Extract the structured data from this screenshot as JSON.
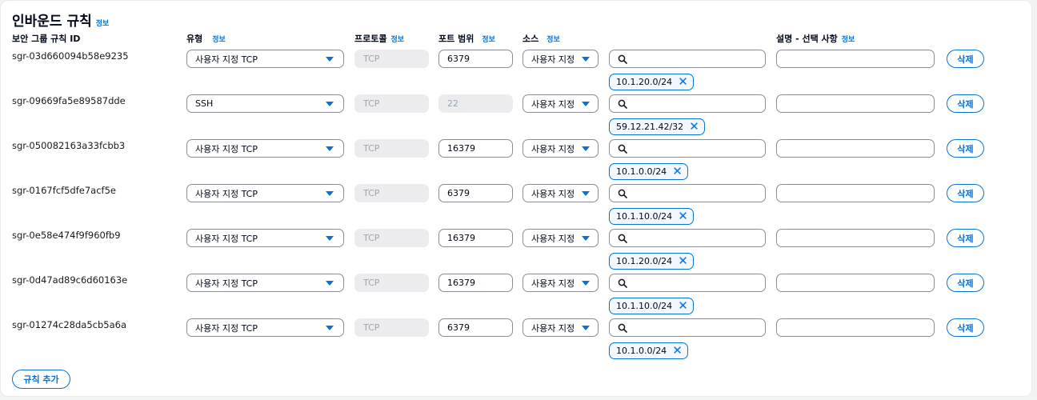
{
  "title": "인바운드 규칙",
  "info_label": "정보",
  "headers": {
    "rule_id": "보안 그룹 규칙 ID",
    "type": "유형",
    "protocol": "프로토콜",
    "port": "포트 범위",
    "source": "소스",
    "description": "설명 - 선택 사항"
  },
  "rules": [
    {
      "id": "sgr-03d660094b58e9235",
      "type": "사용자 지정 TCP",
      "protocol": "TCP",
      "port": "6379",
      "port_disabled": false,
      "source": "사용자 지정",
      "cidr": "10.1.20.0/24"
    },
    {
      "id": "sgr-09669fa5e89587dde",
      "type": "SSH",
      "protocol": "TCP",
      "port": "22",
      "port_disabled": true,
      "source": "사용자 지정",
      "cidr": "59.12.21.42/32"
    },
    {
      "id": "sgr-050082163a33fcbb3",
      "type": "사용자 지정 TCP",
      "protocol": "TCP",
      "port": "16379",
      "port_disabled": false,
      "source": "사용자 지정",
      "cidr": "10.1.0.0/24"
    },
    {
      "id": "sgr-0167fcf5dfe7acf5e",
      "type": "사용자 지정 TCP",
      "protocol": "TCP",
      "port": "6379",
      "port_disabled": false,
      "source": "사용자 지정",
      "cidr": "10.1.10.0/24"
    },
    {
      "id": "sgr-0e58e474f9f960fb9",
      "type": "사용자 지정 TCP",
      "protocol": "TCP",
      "port": "16379",
      "port_disabled": false,
      "source": "사용자 지정",
      "cidr": "10.1.20.0/24"
    },
    {
      "id": "sgr-0d47ad89c6d60163e",
      "type": "사용자 지정 TCP",
      "protocol": "TCP",
      "port": "16379",
      "port_disabled": false,
      "source": "사용자 지정",
      "cidr": "10.1.10.0/24"
    },
    {
      "id": "sgr-01274c28da5cb5a6a",
      "type": "사용자 지정 TCP",
      "protocol": "TCP",
      "port": "6379",
      "port_disabled": false,
      "source": "사용자 지정",
      "cidr": "10.1.0.0/24"
    }
  ],
  "delete_label": "삭제",
  "add_rule_label": "규칙 추가",
  "search_placeholder": "",
  "description_placeholder": "",
  "colors": {
    "accent": "#0972d3",
    "disabled_bg": "#ececef",
    "text": "#16191f"
  },
  "icons": {
    "search": "search-icon",
    "dropdown": "caret-down-icon",
    "remove": "close-icon"
  }
}
